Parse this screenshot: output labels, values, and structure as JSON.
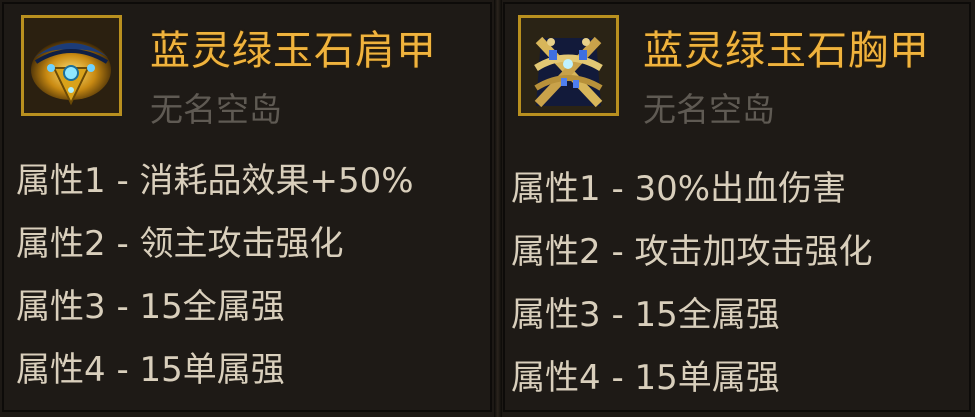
{
  "tooltips": [
    {
      "item_name": "蓝灵绿玉石肩甲",
      "owner": "无名空岛",
      "icon": "shoulder-armor-icon",
      "attributes": [
        "属性1 - 消耗品效果+50%",
        "属性2 - 领主攻击强化",
        "属性3 - 15全属强",
        "属性4 - 15单属强"
      ]
    },
    {
      "item_name": "蓝灵绿玉石胸甲",
      "owner": "无名空岛",
      "icon": "chest-armor-icon",
      "attributes": [
        "属性1 - 30%出血伤害",
        "属性2 - 攻击加攻击强化",
        "属性3 - 15全属强",
        "属性4 - 15单属强"
      ]
    }
  ],
  "colors": {
    "item_name": "#f0b33d",
    "owner": "#5f5a53",
    "attribute": "#d9cfbc",
    "background": "#1e1a16",
    "icon_border": "#b9901f"
  }
}
